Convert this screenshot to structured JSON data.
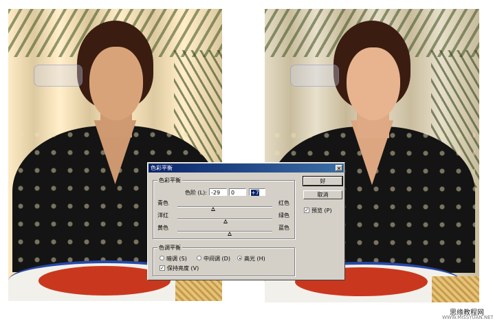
{
  "dialog": {
    "title": "色彩平衡",
    "close_glyph": "✕",
    "color_balance": {
      "group_title": "色彩平衡",
      "levels_label": "色阶 (L):",
      "levels": [
        "-29",
        "0",
        "+7"
      ],
      "sliders": [
        {
          "left": "青色",
          "right": "红色",
          "value": -29
        },
        {
          "left": "洋红",
          "right": "绿色",
          "value": 0
        },
        {
          "left": "黄色",
          "right": "蓝色",
          "value": 7
        }
      ]
    },
    "tone_balance": {
      "group_title": "色调平衡",
      "options": [
        {
          "label": "暗调 (S)",
          "selected": false
        },
        {
          "label": "中间调 (D)",
          "selected": false
        },
        {
          "label": "高光 (H)",
          "selected": true
        }
      ],
      "preserve_luminosity": {
        "label": "保持亮度 (V)",
        "checked": true
      }
    },
    "buttons": {
      "ok": "好",
      "cancel": "取消"
    },
    "preview": {
      "label": "预览 (P)",
      "checked": true
    }
  },
  "watermark": {
    "site_name": "思缘教程网",
    "site_url": "WWW.MISSYUAN.NET"
  },
  "colors": {
    "title_bar": "#0a246a",
    "dialog_bg": "#d4d0c8"
  }
}
